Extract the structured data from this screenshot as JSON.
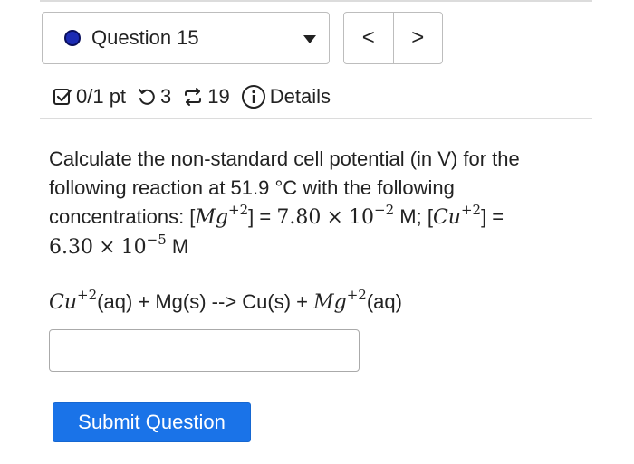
{
  "question_nav": {
    "current_label": "Question 15",
    "prev_glyph": "<",
    "next_glyph": ">"
  },
  "meta": {
    "score": "0/1 pt",
    "retries": "3",
    "attempts": "19",
    "details_label": "Details"
  },
  "question": {
    "intro": "Calculate the non-standard cell potential (in V) for the following reaction at 51.9 °C with the following concentrations: [",
    "mg_species": "Mg",
    "mg_charge": "+2",
    "eq1": "] = ",
    "mg_conc_mantissa": "7.80",
    "times": "×",
    "ten": "10",
    "mg_conc_exp": "−2",
    "unit1": " M; [",
    "cu_species": "Cu",
    "cu_charge": "+2",
    "eq2": "] = ",
    "cu_conc_mantissa": "6.30",
    "cu_conc_exp": "−5",
    "unit2": " M"
  },
  "reaction": {
    "reactant_species": "Cu",
    "reactant_charge": "+2",
    "middle": "(aq) + Mg(s) --> Cu(s) + ",
    "product_species": "Mg",
    "product_charge": "+2",
    "end": "(aq)"
  },
  "answer": {
    "value": "",
    "placeholder": ""
  },
  "submit": {
    "label": "Submit Question"
  },
  "colors": {
    "accent": "#1a73e8",
    "dot": "#1c2bb3"
  }
}
